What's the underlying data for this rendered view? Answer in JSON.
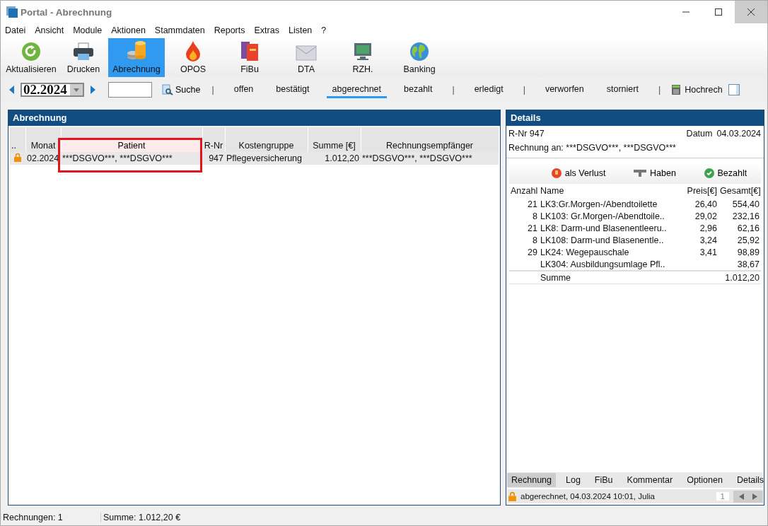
{
  "window": {
    "title": "Portal - Abrechnung"
  },
  "menu": [
    "Datei",
    "Ansicht",
    "Module",
    "Aktionen",
    "Stammdaten",
    "Reports",
    "Extras",
    "Listen",
    "?"
  ],
  "toolbar": [
    {
      "label": "Aktualisieren",
      "selected": false
    },
    {
      "label": "Drucken",
      "selected": false
    },
    {
      "label": "Abrechnung",
      "selected": true
    },
    {
      "label": "OPOS",
      "selected": false
    },
    {
      "label": "FiBu",
      "selected": false
    },
    {
      "label": "DTA",
      "selected": false
    },
    {
      "label": "RZH.",
      "selected": false
    },
    {
      "label": "Banking",
      "selected": false
    }
  ],
  "navigation": {
    "period": "02.2024",
    "search_label": "Suche",
    "extra_label": "Hochrech"
  },
  "filters": [
    {
      "kind": "separator",
      "label": "|"
    },
    {
      "kind": "tab",
      "label": "offen",
      "selected": false
    },
    {
      "kind": "tab",
      "label": "bestätigt",
      "selected": false
    },
    {
      "kind": "tab",
      "label": "abgerechnet",
      "selected": true
    },
    {
      "kind": "tab",
      "label": "bezahlt",
      "selected": false
    },
    {
      "kind": "separator",
      "label": "|"
    },
    {
      "kind": "tab",
      "label": "erledigt",
      "selected": false
    },
    {
      "kind": "separator",
      "label": "|"
    },
    {
      "kind": "tab",
      "label": "verworfen",
      "selected": false
    },
    {
      "kind": "tab",
      "label": "storniert",
      "selected": false
    },
    {
      "kind": "separator",
      "label": "|"
    }
  ],
  "billing_panel": {
    "title": "Abrechnung",
    "columns": [
      {
        "label": "..",
        "highlighted": false
      },
      {
        "label": "Monat",
        "highlighted": false
      },
      {
        "label": "Patient",
        "highlighted": true
      },
      {
        "label": "R-Nr",
        "highlighted": false
      },
      {
        "label": "Kostengruppe",
        "highlighted": false
      },
      {
        "label": "Summe [€]",
        "highlighted": false
      },
      {
        "label": "Rechnungsempfänger",
        "highlighted": false
      }
    ],
    "rows": [
      {
        "locked": true,
        "month": "02.2024",
        "patient": "***DSGVO***, ***DSGVO***",
        "number": "947",
        "cost_group": "Pflegeversicherung",
        "sum": "1.012,20",
        "recipient": "***DSGVO***, ***DSGVO***"
      }
    ]
  },
  "details_panel": {
    "title": "Details",
    "invoice_number": "R-Nr 947",
    "date_label": "Datum",
    "date": "04.03.2024",
    "recipient_line": "Rechnung an: ***DSGVO***, ***DSGVO***",
    "actions": [
      "als Verlust",
      "Haben",
      "Bezahlt"
    ],
    "columns": [
      "Anzahl",
      "Name",
      "Preis[€]",
      "Gesamt[€]"
    ],
    "items": [
      {
        "count": "21",
        "name": "LK3:Gr.Morgen-/Abendtoilette",
        "price": "26,40",
        "total": "554,40"
      },
      {
        "count": "8",
        "name": "LK103: Gr.Morgen-/Abendtoile..",
        "price": "29,02",
        "total": "232,16"
      },
      {
        "count": "21",
        "name": "LK8: Darm-und Blasenentleeru..",
        "price": "2,96",
        "total": "62,16"
      },
      {
        "count": "8",
        "name": "LK108: Darm-und Blasenentle..",
        "price": "3,24",
        "total": "25,92"
      },
      {
        "count": "29",
        "name": "LK24: Wegepauschale",
        "price": "3,41",
        "total": "98,89"
      },
      {
        "name": "LK304: Ausbildungsumlage Pfl..",
        "total": "38,67"
      }
    ],
    "sum_label": "Summe",
    "sum": "1.012,20",
    "tabs": [
      {
        "label": "Rechnung",
        "selected": true
      },
      {
        "label": "Log",
        "selected": false
      },
      {
        "label": "FiBu",
        "selected": false
      },
      {
        "label": "Kommentar",
        "selected": false
      },
      {
        "label": "Optionen",
        "selected": false
      },
      {
        "label": "Details",
        "selected": false
      }
    ],
    "status": {
      "locked": true,
      "text": "abgerechnet, 04.03.2024 10:01, Julia",
      "page": "1"
    }
  },
  "status_bar": [
    "Rechnungen: 1",
    "Summe: 1.012,20 €"
  ]
}
